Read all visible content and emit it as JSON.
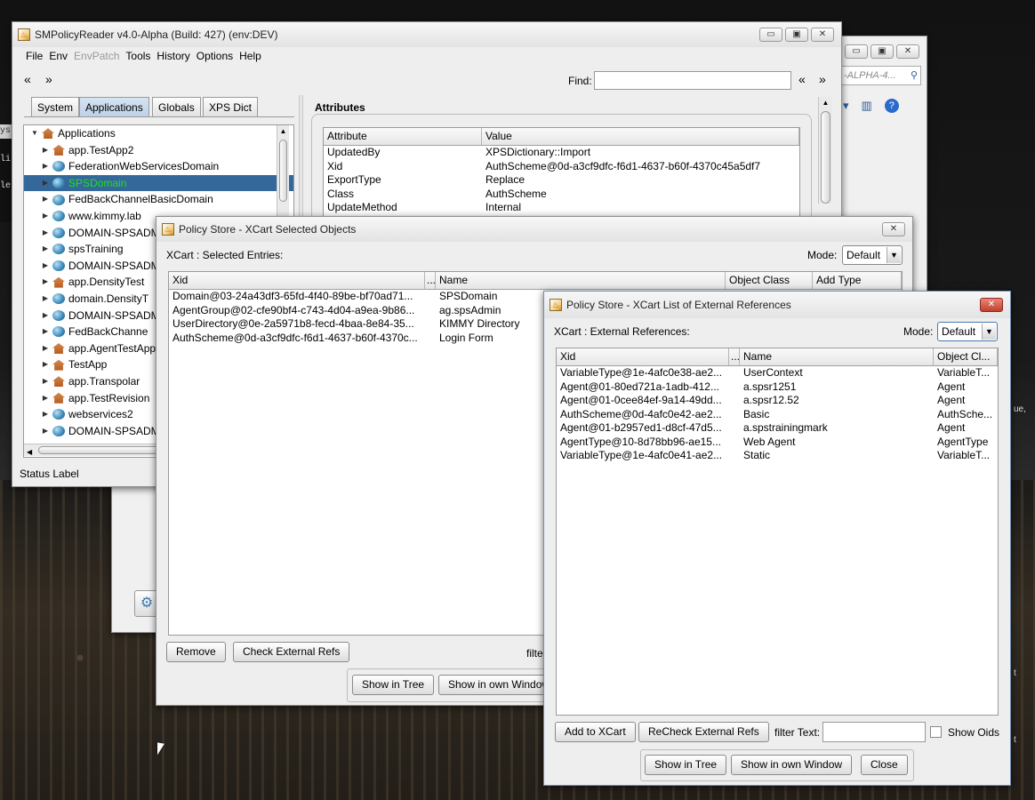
{
  "main": {
    "title": "SMPolicyReader v4.0-Alpha (Build: 427) (env:DEV)",
    "menu": [
      "File",
      "Env",
      "EnvPatch",
      "Tools",
      "History",
      "Options",
      "Help"
    ],
    "find_label": "Find:",
    "tabs": [
      "System",
      "Applications",
      "Globals",
      "XPS Dict"
    ],
    "tree_root": "Applications",
    "tree_items": [
      "app.TestApp2",
      "FederationWebServicesDomain",
      "SPSDomain",
      "FedBackChannelBasicDomain",
      "www.kimmy.lab",
      "DOMAIN-SPSADM",
      "spsTraining",
      "DOMAIN-SPSADM",
      "app.DensityTest",
      "domain.DensityT",
      "DOMAIN-SPSADM",
      "FedBackChanne",
      "app.AgentTestApp",
      "TestApp",
      "app.Transpolar",
      "app.TestRevision",
      "webservices2",
      "DOMAIN-SPSADM"
    ],
    "tree_icons": [
      "house",
      "globe",
      "globe",
      "globe",
      "globe",
      "globe",
      "globe",
      "globe",
      "house",
      "globe",
      "globe",
      "globe",
      "house",
      "house",
      "house",
      "house",
      "globe",
      "globe"
    ],
    "selected_index": 2,
    "attributes_title": "Attributes",
    "attr_headers": [
      "Attribute",
      "Value"
    ],
    "attr_rows": [
      [
        "UpdatedBy",
        "XPSDictionary::Import"
      ],
      [
        "Xid",
        "AuthScheme@0d-a3cf9dfc-f6d1-4637-b60f-4370c45a5df7"
      ],
      [
        "ExportType",
        "Replace"
      ],
      [
        "Class",
        "AuthScheme"
      ],
      [
        "UpdateMethod",
        "Internal"
      ]
    ],
    "status": "Status Label"
  },
  "bgwin": {
    "search_text": "-ALPHA-4..."
  },
  "xcart": {
    "title": "Policy Store - XCart Selected Objects",
    "entries_label": "XCart : Selected Entries:",
    "mode_label": "Mode:",
    "mode_value": "Default",
    "headers": [
      "Xid",
      "...",
      "Name",
      "Object Class",
      "Add Type"
    ],
    "rows": [
      [
        "Domain@03-24a43df3-65fd-4f40-89be-bf70ad71...",
        "SPSDomain"
      ],
      [
        "AgentGroup@02-cfe90bf4-c743-4d04-a9ea-9b86...",
        "ag.spsAdmin"
      ],
      [
        "UserDirectory@0e-2a5971b8-fecd-4baa-8e84-35...",
        "KIMMY Directory"
      ],
      [
        "AuthScheme@0d-a3cf9dfc-f6d1-4637-b60f-4370c...",
        "Login Form"
      ]
    ],
    "remove": "Remove",
    "check_refs": "Check External Refs",
    "filter_partial": "filte",
    "show_tree": "Show in Tree",
    "show_window": "Show in own Window"
  },
  "ext": {
    "title": "Policy Store - XCart List of External References",
    "entries_label": "XCart : External References:",
    "mode_label": "Mode:",
    "mode_value": "Default",
    "headers": [
      "Xid",
      "...",
      "Name",
      "Object Cl..."
    ],
    "rows": [
      [
        "VariableType@1e-4afc0e38-ae2...",
        "UserContext",
        "VariableT..."
      ],
      [
        "Agent@01-80ed721a-1adb-412...",
        "a.spsr1251",
        "Agent"
      ],
      [
        "Agent@01-0cee84ef-9a14-49dd...",
        "a.spsr12.52",
        "Agent"
      ],
      [
        "AuthScheme@0d-4afc0e42-ae2...",
        "Basic",
        "AuthSche..."
      ],
      [
        "Agent@01-b2957ed1-d8cf-47d5...",
        "a.spstrainingmark",
        "Agent"
      ],
      [
        "AgentType@10-8d78bb96-ae15...",
        "Web Agent",
        "AgentType"
      ],
      [
        "VariableType@1e-4afc0e41-ae2...",
        "Static",
        "VariableT..."
      ]
    ],
    "add": "Add to XCart",
    "recheck": "ReCheck External Refs",
    "filter_label": "filter Text:",
    "show_oids": "Show Oids",
    "show_tree": "Show in Tree",
    "show_window": "Show in own Window",
    "close": "Close"
  },
  "edge_text": {
    "left1": "yst",
    "left2": "li",
    "left3": "le",
    "right1": "ue,",
    "right2": "t",
    "right3": "t"
  },
  "colors": {
    "selection": "#34689a",
    "selected_text": "#22dd22",
    "accent_close": "#c1402e"
  }
}
